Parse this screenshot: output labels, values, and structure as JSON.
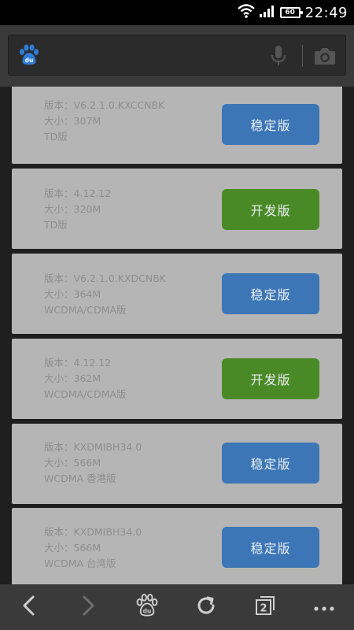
{
  "status_bar": {
    "battery_level": "60",
    "time": "22:49"
  },
  "search": {
    "logo_text": "du"
  },
  "versions": [
    {
      "version": "版本：V6.2.1.0.KXCCNBK",
      "size": "大小：307M",
      "network": "TD版",
      "button_label": "稳定版",
      "button_color": "#3d76b6"
    },
    {
      "version": "版本：4.12.12",
      "size": "大小：320M",
      "network": "TD版",
      "button_label": "开发版",
      "button_color": "#4a8a26"
    },
    {
      "version": "版本：V6.2.1.0.KXDCNBK",
      "size": "大小：364M",
      "network": "WCDMA/CDMA版",
      "button_label": "稳定版",
      "button_color": "#3d76b6"
    },
    {
      "version": "版本：4.12.12",
      "size": "大小：362M",
      "network": "WCDMA/CDMA版",
      "button_label": "开发版",
      "button_color": "#4a8a26"
    },
    {
      "version": "版本：KXDMIBH34.0",
      "size": "大小：566M",
      "network": "WCDMA 香港版",
      "button_label": "稳定版",
      "button_color": "#3d76b6"
    },
    {
      "version": "版本：KXDMIBH34.0",
      "size": "大小：566M",
      "network": "WCDMA 台湾版",
      "button_label": "稳定版",
      "button_color": "#3d76b6"
    }
  ],
  "bottom_nav": {
    "tab_count": "2",
    "icons": [
      "back-icon",
      "forward-icon",
      "baidu-home-icon",
      "refresh-icon",
      "tabs-icon",
      "more-icon"
    ]
  },
  "colors": {
    "stable_button": "#3d76b6",
    "dev_button": "#4a8a26",
    "card_background": "#b5b5b5",
    "toolbar_background": "#3a3a3a"
  }
}
